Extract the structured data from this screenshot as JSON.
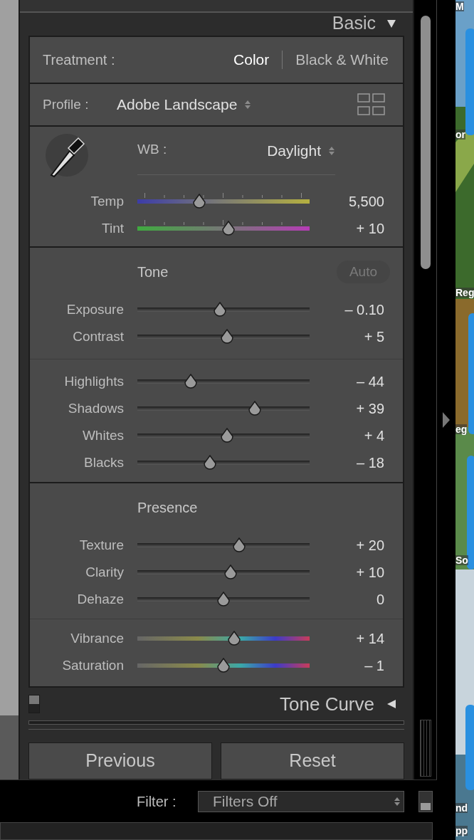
{
  "header": {
    "title": "Basic",
    "expanded": true
  },
  "treatment": {
    "label": "Treatment :",
    "options": [
      {
        "label": "Color",
        "selected": true
      },
      {
        "label": "Black & White",
        "selected": false
      }
    ]
  },
  "profile": {
    "label": "Profile :",
    "value": "Adobe Landscape"
  },
  "white_balance": {
    "label": "WB :",
    "value": "Daylight",
    "sliders": [
      {
        "label": "Temp",
        "value": "5,500",
        "level": 0.36,
        "kind": "temp"
      },
      {
        "label": "Tint",
        "value": "+ 10",
        "level": 0.53,
        "kind": "tint"
      }
    ]
  },
  "tone": {
    "title": "Tone",
    "auto": "Auto",
    "groups": [
      [
        {
          "label": "Exposure",
          "value": "– 0.10",
          "level": 0.48,
          "kind": "plain"
        },
        {
          "label": "Contrast",
          "value": "+ 5",
          "level": 0.52,
          "kind": "plain"
        }
      ],
      [
        {
          "label": "Highlights",
          "value": "– 44",
          "level": 0.31,
          "kind": "plain"
        },
        {
          "label": "Shadows",
          "value": "+ 39",
          "level": 0.68,
          "kind": "plain"
        },
        {
          "label": "Whites",
          "value": "+ 4",
          "level": 0.52,
          "kind": "plain"
        },
        {
          "label": "Blacks",
          "value": "– 18",
          "level": 0.42,
          "kind": "plain"
        }
      ]
    ]
  },
  "presence": {
    "title": "Presence",
    "groups": [
      [
        {
          "label": "Texture",
          "value": "+ 20",
          "level": 0.59,
          "kind": "plain"
        },
        {
          "label": "Clarity",
          "value": "+ 10",
          "level": 0.54,
          "kind": "plain"
        },
        {
          "label": "Dehaze",
          "value": "0",
          "level": 0.5,
          "kind": "plain"
        }
      ],
      [
        {
          "label": "Vibrance",
          "value": "+ 14",
          "level": 0.56,
          "kind": "color"
        },
        {
          "label": "Saturation",
          "value": "– 1",
          "level": 0.5,
          "kind": "color"
        }
      ]
    ]
  },
  "tone_curve": {
    "title": "Tone Curve",
    "expanded": false,
    "on": true
  },
  "buttons": [
    "Previous",
    "Reset"
  ],
  "filter": {
    "label": "Filter :",
    "value": "Filters Off",
    "locked": true
  },
  "edge_labels": [
    "M",
    "or",
    "Reg",
    "eg",
    "So",
    "nd",
    "pp"
  ]
}
